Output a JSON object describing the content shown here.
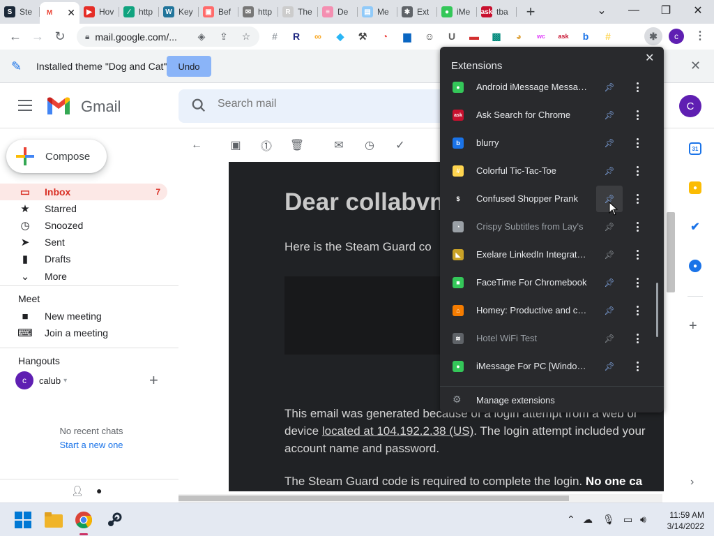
{
  "browser": {
    "tabs": [
      {
        "label": "Ste",
        "color": "#1b2838",
        "glyph": "S"
      },
      {
        "label": "",
        "color": "#ffffff",
        "glyph": "M",
        "active": true
      },
      {
        "label": "Hov",
        "color": "#e52d27",
        "glyph": "▶"
      },
      {
        "label": "http",
        "color": "#10a37f",
        "glyph": "∕"
      },
      {
        "label": "Key",
        "color": "#21759b",
        "glyph": "W"
      },
      {
        "label": "Bef",
        "color": "#ff6b6b",
        "glyph": "▣"
      },
      {
        "label": "http",
        "color": "#777777",
        "glyph": "✉"
      },
      {
        "label": "The",
        "color": "#cccccc",
        "glyph": "R"
      },
      {
        "label": "De",
        "color": "#f48fb1",
        "glyph": "≡"
      },
      {
        "label": "Me",
        "color": "#90caf9",
        "glyph": "▤"
      },
      {
        "label": "Ext",
        "color": "#5f6368",
        "glyph": "✱"
      },
      {
        "label": "iMe",
        "color": "#34c759",
        "glyph": "●"
      },
      {
        "label": "tba",
        "color": "#c8102e",
        "glyph": "ask"
      }
    ],
    "new_tab": "+",
    "window_controls": {
      "dropdown": "⌄",
      "minimize": "—",
      "restore": "❐",
      "close": "✕"
    },
    "address": "mail.google.com/...",
    "toolbar_extensions": [
      {
        "name": "hash",
        "glyph": "#",
        "color": "#9aa0a6"
      },
      {
        "name": "r",
        "glyph": "R",
        "color": "#1a237e"
      },
      {
        "name": "loop",
        "glyph": "∞",
        "color": "#f9a825"
      },
      {
        "name": "puzzle",
        "glyph": "◆",
        "color": "#29b6f6"
      },
      {
        "name": "tool",
        "glyph": "⚒",
        "color": "#424242"
      },
      {
        "name": "lays",
        "glyph": "◔",
        "color": "#ef5350"
      },
      {
        "name": "linkedin",
        "glyph": "▆",
        "color": "#0a66c2"
      },
      {
        "name": "emoji",
        "glyph": "☺",
        "color": "#424242"
      },
      {
        "name": "u",
        "glyph": "U",
        "color": "#616161"
      },
      {
        "name": "bar",
        "glyph": "▬",
        "color": "#d32f2f"
      },
      {
        "name": "teal",
        "glyph": "▩",
        "color": "#00897b"
      },
      {
        "name": "doge",
        "glyph": "◕",
        "color": "#e0a848"
      },
      {
        "name": "wc",
        "glyph": "wc",
        "color": "#e040fb"
      },
      {
        "name": "ask",
        "glyph": "ask",
        "color": "#c8102e"
      },
      {
        "name": "blurry",
        "glyph": "b",
        "color": "#1a73e8"
      },
      {
        "name": "tictac",
        "glyph": "#",
        "color": "#ffd54f"
      },
      {
        "name": "puzzle-menu",
        "glyph": "✱",
        "color": "#5f6368"
      }
    ],
    "profile_initial": "c"
  },
  "infobar": {
    "message": "Installed theme \"Dog and Cat\"",
    "undo": "Undo",
    "close": "✕"
  },
  "gmail": {
    "brand": "Gmail",
    "search_placeholder": "Search mail",
    "avatar_initial": "C",
    "compose": "Compose",
    "nav": [
      {
        "label": "Inbox",
        "icon": "▭",
        "count": "7",
        "active": true
      },
      {
        "label": "Starred",
        "icon": "★",
        "count": ""
      },
      {
        "label": "Snoozed",
        "icon": "◷",
        "count": ""
      },
      {
        "label": "Sent",
        "icon": "➤",
        "count": ""
      },
      {
        "label": "Drafts",
        "icon": "▮",
        "count": ""
      },
      {
        "label": "More",
        "icon": "⌄",
        "count": ""
      }
    ],
    "meet": {
      "title": "Meet",
      "items": [
        {
          "label": "New meeting",
          "icon": "■"
        },
        {
          "label": "Join a meeting",
          "icon": "⌨"
        }
      ]
    },
    "hangouts": {
      "title": "Hangouts",
      "user": "calub",
      "user_initial": "c",
      "caret": "▾",
      "add": "+",
      "no_chats": "No recent chats",
      "start_new": "Start a new one"
    },
    "email": {
      "heading": "Dear collabvm",
      "intro": "Here is the Steam Guard co",
      "body_pre": "This email was generated because of a login attempt from a web or",
      "body_device": "device",
      "body_link": "located at 104.192.2.38 (US)",
      "body_post": ". The login attempt included your account name and password.",
      "footer_pre": "The Steam Guard code is required to complete the login.",
      "footer_bold": "No one ca"
    }
  },
  "extensions_popup": {
    "title": "Extensions",
    "close": "✕",
    "items": [
      {
        "name": "Android iMessage Message...",
        "color": "#34c759",
        "glyph": "●",
        "pinned": true
      },
      {
        "name": "Ask Search for Chrome",
        "color": "#c8102e",
        "glyph": "ask",
        "pinned": true
      },
      {
        "name": "blurry",
        "color": "#1a73e8",
        "glyph": "b",
        "pinned": true
      },
      {
        "name": "Colorful Tic-Tac-Toe",
        "color": "#ffd54f",
        "glyph": "#",
        "pinned": true
      },
      {
        "name": "Confused Shopper Prank",
        "color": "#292a2d",
        "glyph": "$",
        "pinned": true,
        "hover": true
      },
      {
        "name": "Crispy Subtitles from Lay's",
        "color": "#9aa0a6",
        "glyph": "◔",
        "pinned": false,
        "dim": true
      },
      {
        "name": "Exelare LinkedIn Integration",
        "color": "#c9a227",
        "glyph": "◣",
        "pinned": false
      },
      {
        "name": "FaceTime For Chromebook",
        "color": "#34c759",
        "glyph": "■",
        "pinned": true
      },
      {
        "name": "Homey: Productive and coz...",
        "color": "#f57c00",
        "glyph": "⌂",
        "pinned": true
      },
      {
        "name": "Hotel WiFi Test",
        "color": "#5f6368",
        "glyph": "≋",
        "pinned": true,
        "dim": true
      },
      {
        "name": "iMessage For PC [Window 1...",
        "color": "#34c759",
        "glyph": "●",
        "pinned": true
      }
    ],
    "manage": "Manage extensions"
  },
  "taskbar": {
    "time": "11:59 AM",
    "date": "3/14/2022"
  }
}
